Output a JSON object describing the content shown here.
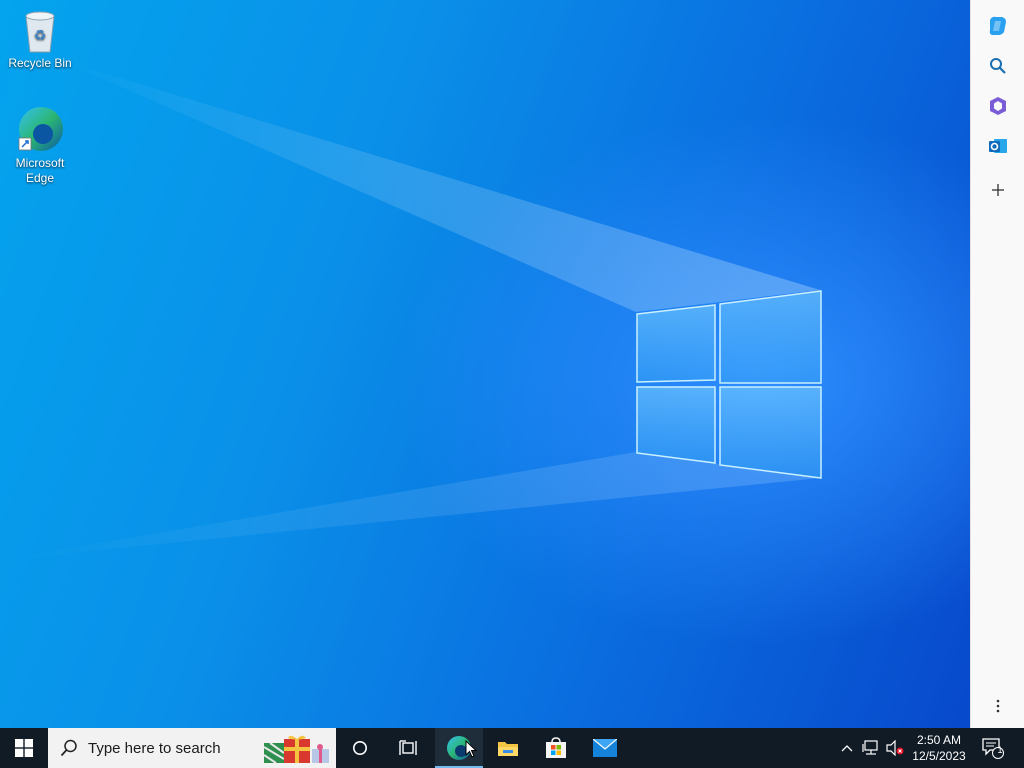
{
  "desktop": {
    "icons": [
      {
        "label": "Recycle Bin",
        "icon": "recycle-bin-icon"
      },
      {
        "label": "Microsoft Edge",
        "icon": "edge-icon"
      }
    ]
  },
  "sidebar": {
    "buttons": [
      "copilot-icon",
      "search-icon",
      "office-icon",
      "outlook-icon",
      "plus-icon",
      "more-icon"
    ]
  },
  "taskbar": {
    "search_placeholder": "Type here to search",
    "apps": [
      "cortana-icon",
      "task-view-icon",
      "edge-icon",
      "file-explorer-icon",
      "store-icon",
      "mail-icon"
    ],
    "tray": {
      "time": "2:50 AM",
      "date": "12/5/2023",
      "notification_count": "1"
    }
  },
  "colors": {
    "taskbar": "#101b26",
    "accent": "#0a78e8",
    "sidebar_bg": "#f9f9f9"
  }
}
